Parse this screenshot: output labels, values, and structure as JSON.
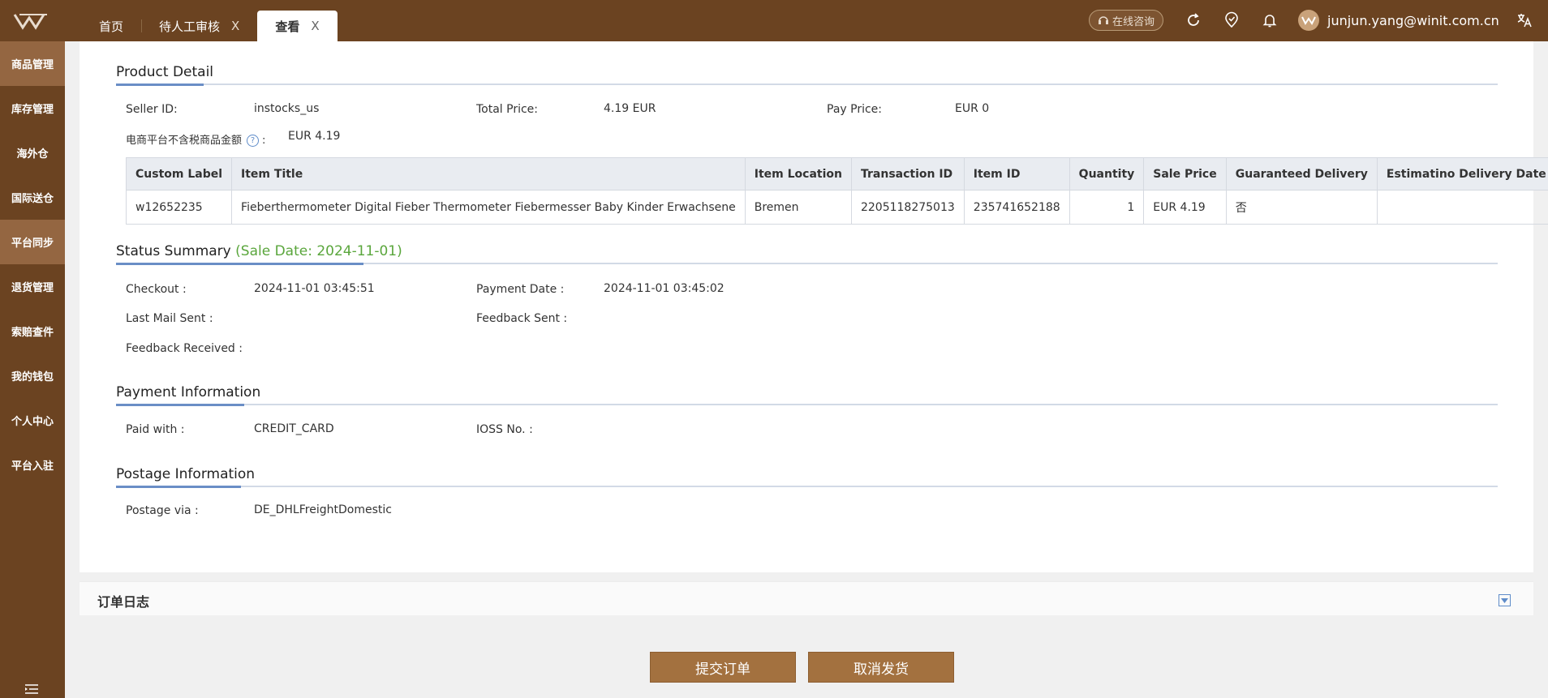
{
  "header": {
    "tabs": [
      {
        "label": "首页"
      },
      {
        "label": "待人工审核",
        "close": "X"
      },
      {
        "label": "查看",
        "close": "X"
      }
    ],
    "online_consult": "在线咨询",
    "user_email": "junjun.yang@winit.com.cn"
  },
  "sidebar": {
    "items": [
      {
        "label": "商品管理"
      },
      {
        "label": "库存管理"
      },
      {
        "label": "海外仓"
      },
      {
        "label": "国际送仓"
      },
      {
        "label": "平台同步"
      },
      {
        "label": "退货管理"
      },
      {
        "label": "索赔查件"
      },
      {
        "label": "我的钱包"
      },
      {
        "label": "个人中心"
      },
      {
        "label": "平台入驻"
      }
    ]
  },
  "product_detail": {
    "title": "Product Detail",
    "seller_id_label": "Seller ID:",
    "seller_id": "instocks_us",
    "total_price_label": "Total Price:",
    "total_price": "4.19 EUR",
    "pay_price_label": "Pay Price:",
    "pay_price": "EUR  0",
    "tax_free_label": "电商平台不含税商品金额",
    "tax_free_help": "?",
    "tax_free_colon": ":",
    "tax_free_value": "EUR  4.19",
    "table": {
      "columns": [
        "Custom Label",
        "Item Title",
        "Item Location",
        "Transaction ID",
        "Item ID",
        "Quantity",
        "Sale Price",
        "Guaranteed Delivery",
        "Estimatino Delivery Date"
      ],
      "rows": [
        [
          "w12652235",
          "Fieberthermometer Digital Fieber Thermometer Fiebermesser Baby Kinder Erwachsene",
          "Bremen",
          "2205118275013",
          "235741652188",
          "1",
          "EUR  4.19",
          "否",
          ""
        ]
      ]
    }
  },
  "status_summary": {
    "title": "Status Summary",
    "sale_date": "(Sale Date: 2024-11-01)",
    "checkout_label": "Checkout :",
    "checkout": "2024-11-01 03:45:51",
    "payment_date_label": "Payment Date :",
    "payment_date": "2024-11-01 03:45:02",
    "last_mail_label": "Last Mail Sent :",
    "feedback_sent_label": "Feedback Sent :",
    "feedback_received_label": "Feedback Received :"
  },
  "payment": {
    "title": "Payment Information",
    "paid_with_label": "Paid with :",
    "paid_with": "CREDIT_CARD",
    "ioss_label": "IOSS No. :"
  },
  "postage": {
    "title": "Postage Information",
    "postage_via_label": "Postage via :",
    "postage_via": "DE_DHLFreightDomestic"
  },
  "order_log": {
    "title": "订单日志"
  },
  "actions": {
    "submit": "提交订单",
    "cancel": "取消发货"
  }
}
